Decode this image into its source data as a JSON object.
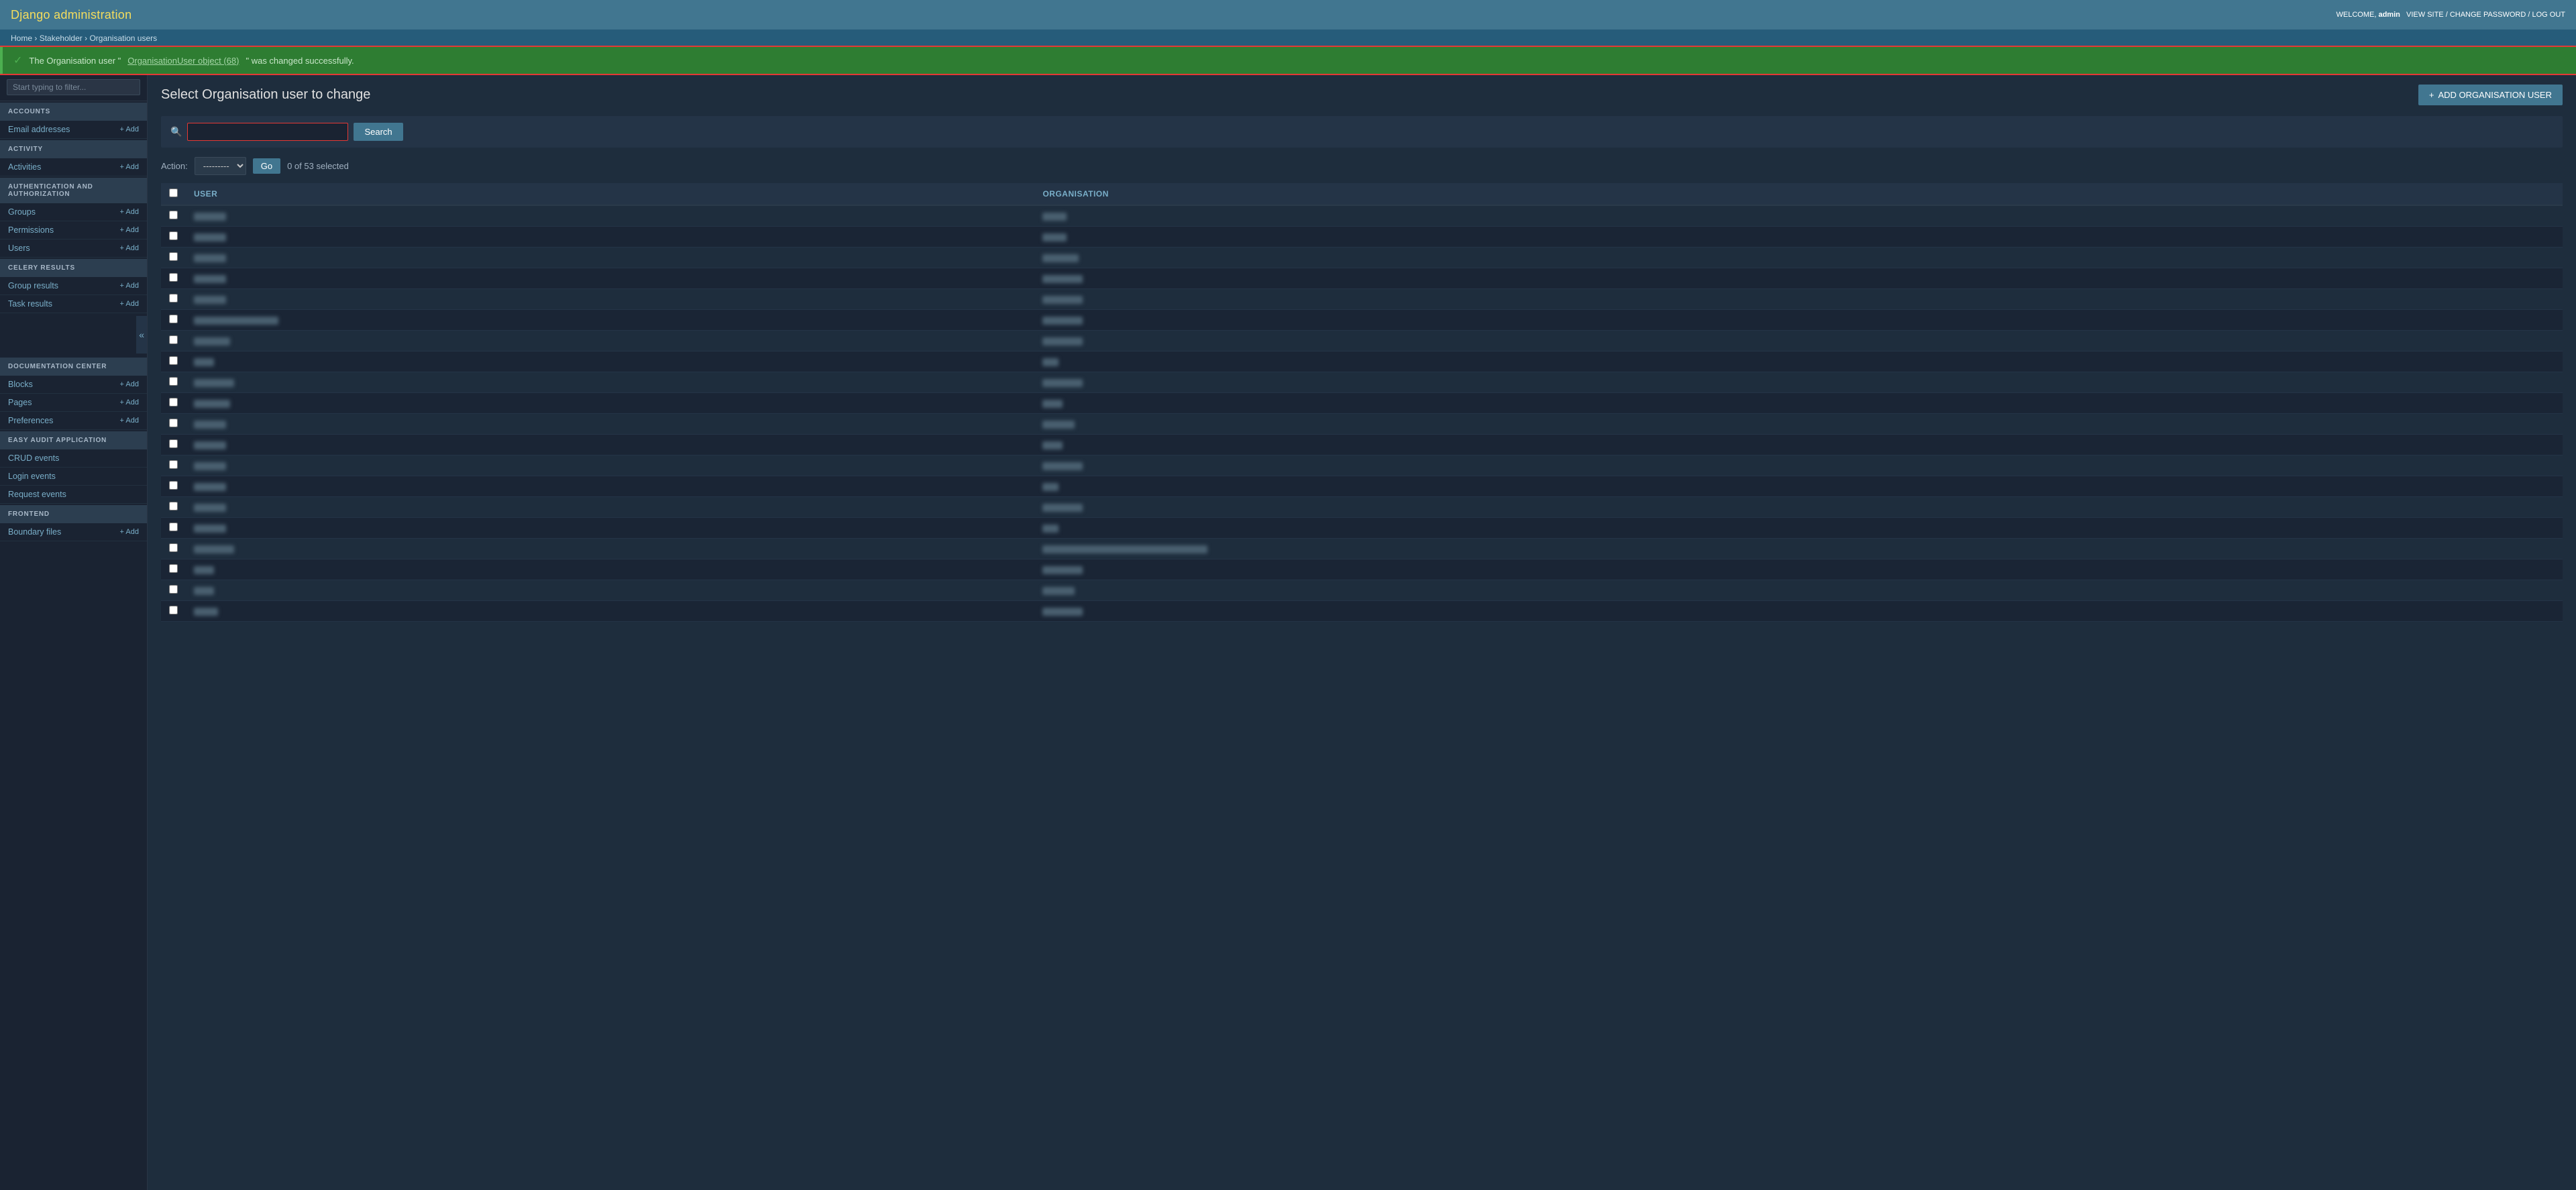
{
  "header": {
    "title": "Django administration",
    "welcome_text": "WELCOME,",
    "username": "admin",
    "view_site": "VIEW SITE",
    "change_password": "CHANGE PASSWORD",
    "logout": "LOG OUT"
  },
  "breadcrumb": {
    "home": "Home",
    "stakeholder": "Stakeholder",
    "current": "Organisation users"
  },
  "sidebar": {
    "filter_placeholder": "Start typing to filter...",
    "sections": [
      {
        "title": "ACCOUNTS",
        "items": [
          {
            "label": "Email addresses",
            "has_add": true
          }
        ]
      },
      {
        "title": "ACTIVITY",
        "items": [
          {
            "label": "Activities",
            "has_add": true
          }
        ]
      },
      {
        "title": "AUTHENTICATION AND AUTHORIZATION",
        "items": [
          {
            "label": "Groups",
            "has_add": true
          },
          {
            "label": "Permissions",
            "has_add": true
          },
          {
            "label": "Users",
            "has_add": true
          }
        ]
      },
      {
        "title": "CELERY RESULTS",
        "items": [
          {
            "label": "Group results",
            "has_add": true
          },
          {
            "label": "Task results",
            "has_add": true
          }
        ]
      },
      {
        "title": "DOCUMENTATION CENTER",
        "items": [
          {
            "label": "Blocks",
            "has_add": true
          },
          {
            "label": "Pages",
            "has_add": true
          },
          {
            "label": "Preferences",
            "has_add": true
          }
        ]
      },
      {
        "title": "EASY AUDIT APPLICATION",
        "items": [
          {
            "label": "CRUD events",
            "has_add": false
          },
          {
            "label": "Login events",
            "has_add": false
          },
          {
            "label": "Request events",
            "has_add": false
          }
        ]
      },
      {
        "title": "FRONTEND",
        "items": [
          {
            "label": "Boundary files",
            "has_add": true
          }
        ]
      }
    ]
  },
  "success_message": {
    "text_before": "The Organisation user \"",
    "link_text": "OrganisationUser object (68)",
    "text_after": "\" was changed successfully."
  },
  "content": {
    "title": "Select Organisation user to change",
    "add_button": "ADD ORGANISATION USER",
    "search": {
      "placeholder": "",
      "button_label": "Search"
    },
    "actions": {
      "label": "Action:",
      "default_option": "---------",
      "go_button": "Go",
      "selected_text": "0 of 53 selected"
    },
    "table": {
      "columns": [
        "USER",
        "ORGANISATION"
      ],
      "rows": [
        {
          "user": "xxxxxxxx",
          "org": "xxxxxx"
        },
        {
          "user": "xxxxxxxx",
          "org": "xxxxxx"
        },
        {
          "user": "xxxxxxxx",
          "org": "xxxxxxxxx"
        },
        {
          "user": "xxxxxxxx",
          "org": "xxxxxxxxxx"
        },
        {
          "user": "xxxxxxxx",
          "org": "xxxxxxxxxx"
        },
        {
          "user": "xxxxxxxxxxxxxxxxxxxxx",
          "org": "xxxxxxxxxx"
        },
        {
          "user": "xxxxxxxxx",
          "org": "xxxxxxxxxx"
        },
        {
          "user": "xxxxx",
          "org": "xxxx"
        },
        {
          "user": "xxxxxxxxxx",
          "org": "xxxxxxxxxx"
        },
        {
          "user": "xxxxxxxxx",
          "org": "xxxxx"
        },
        {
          "user": "xxxxxxxx",
          "org": "xxxxxxxx"
        },
        {
          "user": "xxxxxxxx",
          "org": "xxxxx"
        },
        {
          "user": "xxxxxxxx",
          "org": "xxxxxxxxxx"
        },
        {
          "user": "xxxxxxxx",
          "org": "xxxx"
        },
        {
          "user": "xxxxxxxx",
          "org": "xxxxxxxxxx"
        },
        {
          "user": "xxxxxxxx",
          "org": "xxxx"
        },
        {
          "user": "xxxxxxxxxx",
          "org": "xxxxxxxxxxxxxxxxxxxxxxxxxxxxxxxxxxxxxxxxx"
        },
        {
          "user": "xxxxx",
          "org": "xxxxxxxxxx"
        },
        {
          "user": "xxxxx",
          "org": "xxxxxxxx"
        },
        {
          "user": "xxxxxx",
          "org": "xxxxxxxxxx"
        }
      ]
    }
  }
}
